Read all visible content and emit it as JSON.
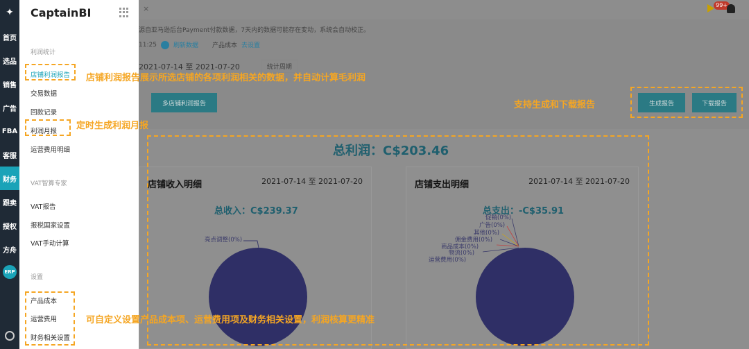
{
  "rail": {
    "items": [
      "首页",
      "选品",
      "销售",
      "广告",
      "FBA",
      "客服",
      "财务",
      "跟卖",
      "授权",
      "方舟"
    ],
    "active_index": 6,
    "erp_label": "ERP"
  },
  "menu": {
    "brand": "CaptainBI",
    "section_profit": "利润统计",
    "section_vat": "VAT智算专家",
    "section_settings": "设置",
    "links_profit": [
      "店铺利润报告",
      "交易数据",
      "回款记录",
      "利润月报",
      "运营费用明细"
    ],
    "links_vat": [
      "VAT报告",
      "报税国家设置",
      "VAT手动计算"
    ],
    "links_settings": [
      "产品成本",
      "运营费用",
      "财务相关设置"
    ]
  },
  "topbar": {
    "close": "×",
    "badge": "99+"
  },
  "notice": "源自亚马逊后台Payment付款数据，7天内的数据可能存在变动，系统会自动校正。",
  "sync": {
    "time": "11:25",
    "refresh": "刷新数据",
    "cost_label": "产品成本",
    "cost_link": "去设置"
  },
  "date_range": "2021-07-14 至 2021-07-20",
  "period_select": "统计周期",
  "toolbar": {
    "multi_store": "多店铺利润报告",
    "generate": "生成报告",
    "download": "下载报告"
  },
  "report": {
    "total_profit": "总利润：C$203.46",
    "income": {
      "title": "店铺收入明细",
      "range": "2021-07-14 至 2021-07-20",
      "sum": "总收入：C$239.37",
      "labels": [
        "亮点调整(0%)"
      ]
    },
    "expense": {
      "title": "店铺支出明细",
      "range": "2021-07-14 至 2021-07-20",
      "sum": "总支出：-C$35.91",
      "labels": [
        "促销(0%)",
        "广告(0%)",
        "其他(0%)",
        "佣金费用(0%)",
        "商品成本(0%)",
        "物流(0%)",
        "运营费用(0%)"
      ]
    }
  },
  "annotations": {
    "store_report": "店铺利润报告展示所选店铺的各项利润相关的数据，并自动计算毛利润",
    "monthly": "定时生成利润月报",
    "generate_download": "支持生成和下载报告",
    "settings": "可自定义设置产品成本项、运营费用项及财务相关设置，利润核算更精准"
  },
  "colors": {
    "accent": "#1aa3b8",
    "annotation": "#f5a623",
    "pie": "#2f2f66"
  }
}
